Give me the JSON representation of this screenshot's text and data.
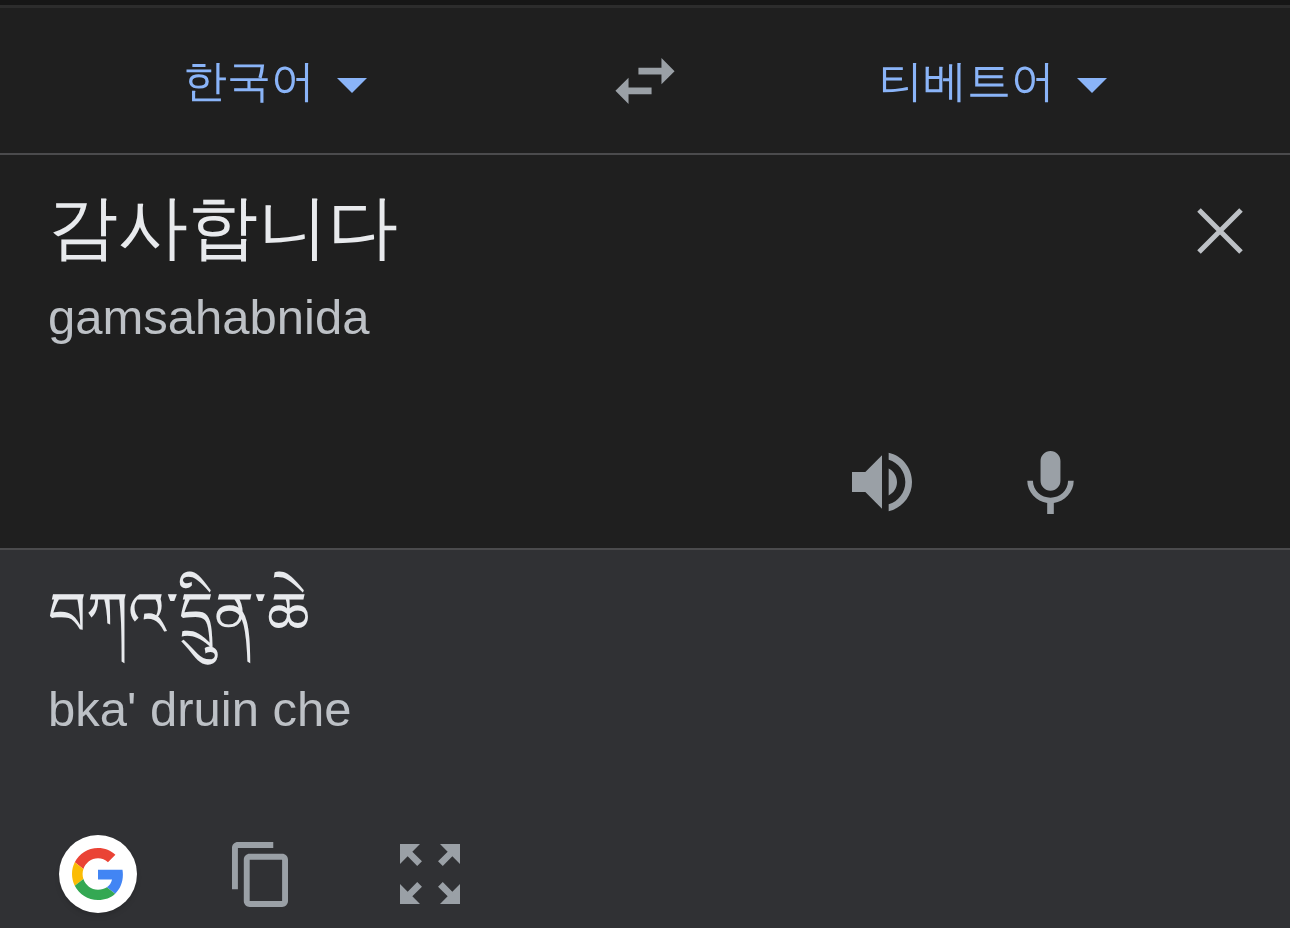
{
  "language_bar": {
    "source_language": "한국어",
    "target_language": "티베트어"
  },
  "input": {
    "text": "감사합니다",
    "romanization": "gamsahabnida"
  },
  "output": {
    "text": "བཀའ་དྲིུན་ཆེ",
    "romanization": "bka' druin che"
  }
}
